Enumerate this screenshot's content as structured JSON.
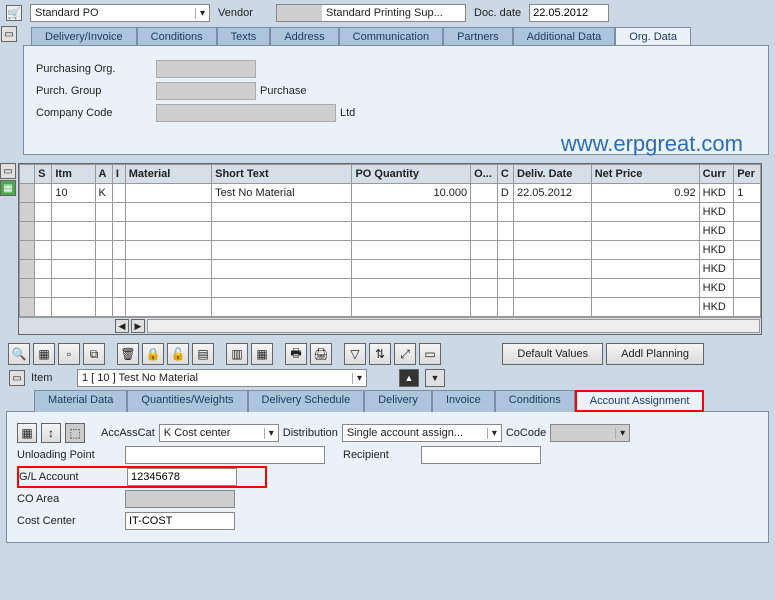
{
  "header": {
    "po_type": "Standard PO",
    "vendor_label": "Vendor",
    "vendor_name": "Standard Printing Sup...",
    "doc_date_label": "Doc. date",
    "doc_date": "22.05.2012"
  },
  "top_tabs": [
    "Delivery/Invoice",
    "Conditions",
    "Texts",
    "Address",
    "Communication",
    "Partners",
    "Additional Data",
    "Org. Data"
  ],
  "org": {
    "purch_org_label": "Purchasing Org.",
    "purch_group_label": "Purch. Group",
    "purch_group_text": "Purchase",
    "company_code_label": "Company Code",
    "company_code_text": "Ltd"
  },
  "watermark": "www.erpgreat.com",
  "grid": {
    "cols": [
      "S",
      "Itm",
      "A",
      "I",
      "Material",
      "Short Text",
      "PO Quantity",
      "O...",
      "C",
      "Deliv. Date",
      "Net Price",
      "Curr",
      "Per"
    ],
    "row1": {
      "itm": "10",
      "a": "K",
      "short_text": "Test No Material",
      "qty": "10.000",
      "c": "D",
      "deliv": "22.05.2012",
      "price": "0.92",
      "curr": "HKD",
      "per": "1"
    },
    "curr_repeat": "HKD"
  },
  "buttons": {
    "default_values": "Default Values",
    "addl_planning": "Addl Planning"
  },
  "item_select": {
    "label": "Item",
    "value": "1 [ 10 ] Test No Material"
  },
  "lower_tabs": [
    "Material Data",
    "Quantities/Weights",
    "Delivery Schedule",
    "Delivery",
    "Invoice",
    "Conditions",
    "Account Assignment"
  ],
  "aa": {
    "small_btns_label": "",
    "accasscat_label": "AccAssCat",
    "accasscat_value": "K Cost center",
    "distribution_label": "Distribution",
    "distribution_value": "Single account assign...",
    "cocode_label": "CoCode",
    "unloading_label": "Unloading Point",
    "recipient_label": "Recipient",
    "gl_label": "G/L Account",
    "gl_value": "12345678",
    "coarea_label": "CO Area",
    "costcenter_label": "Cost Center",
    "costcenter_value": "IT-COST"
  }
}
